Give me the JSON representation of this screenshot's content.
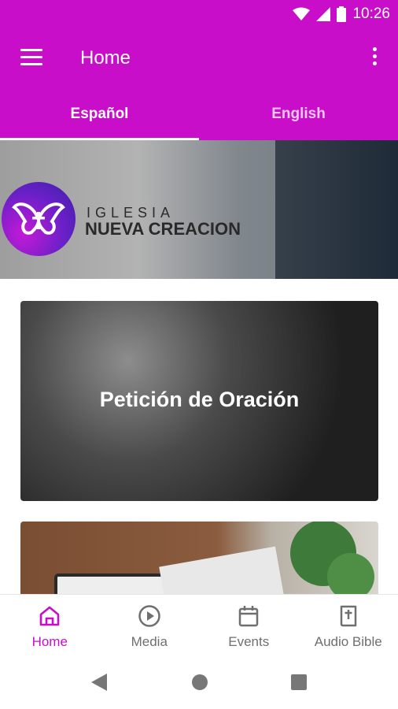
{
  "status_bar": {
    "time": "10:26",
    "icons": [
      "wifi-icon",
      "signal-icon",
      "battery-icon"
    ]
  },
  "app_bar": {
    "title": "Home",
    "menu_icon": "menu-icon",
    "overflow_icon": "more-vert-icon"
  },
  "tabs": [
    {
      "label": "Español",
      "selected": true
    },
    {
      "label": "English",
      "selected": false
    }
  ],
  "banner": {
    "logo_top": "IGLESIA",
    "logo_bottom": "NUEVA CREACION"
  },
  "cards": [
    {
      "title": "Petición de Oración"
    },
    {
      "title": ""
    }
  ],
  "bottom_nav": [
    {
      "label": "Home",
      "icon": "home-icon",
      "active": true
    },
    {
      "label": "Media",
      "icon": "play-circle-icon",
      "active": false
    },
    {
      "label": "Events",
      "icon": "calendar-icon",
      "active": false
    },
    {
      "label": "Audio Bible",
      "icon": "bible-icon",
      "active": false
    }
  ],
  "colors": {
    "primary": "#c80ec8",
    "nav_inactive": "#6f6f6f"
  }
}
